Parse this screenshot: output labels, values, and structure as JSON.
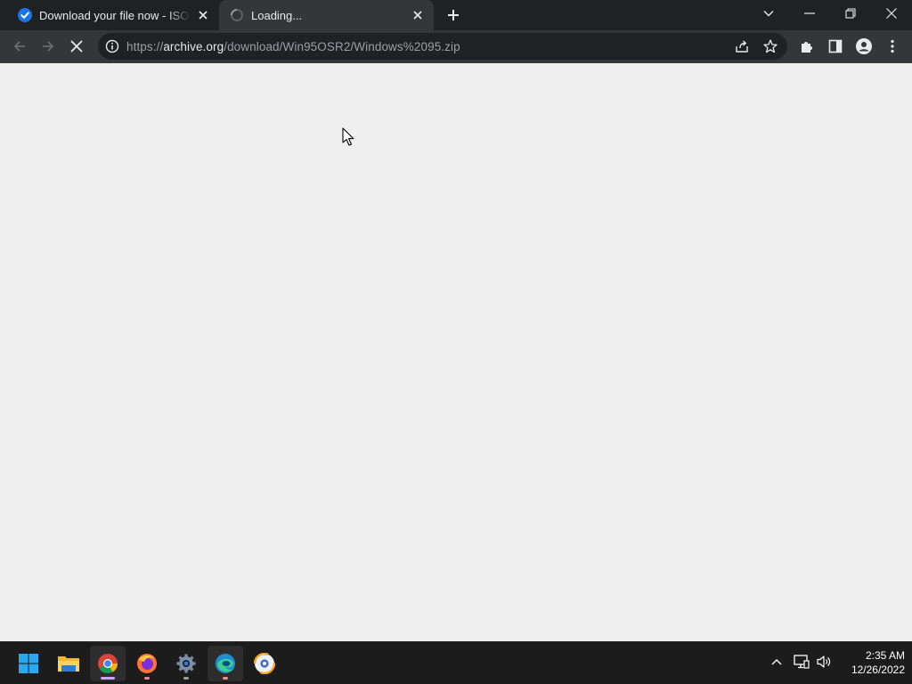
{
  "browser": {
    "tabs": [
      {
        "title": "Download your file now - ISORIVER",
        "favicon": "check-badge-icon",
        "active": false
      },
      {
        "title": "Loading...",
        "favicon": "loading-spinner-icon",
        "active": true
      }
    ],
    "address_bar": {
      "scheme": "https://",
      "host": "archive.org",
      "path": "/download/Win95OSR2/Windows%2095.zip"
    }
  },
  "taskbar": {
    "apps": [
      {
        "name": "Start",
        "icon": "windows-logo-icon"
      },
      {
        "name": "File Explorer",
        "icon": "folder-icon"
      },
      {
        "name": "Google Chrome",
        "icon": "chrome-icon"
      },
      {
        "name": "Firefox",
        "icon": "firefox-icon"
      },
      {
        "name": "Settings",
        "icon": "gear-icon"
      },
      {
        "name": "Microsoft Edge",
        "icon": "edge-icon"
      },
      {
        "name": "Brave",
        "icon": "brave-icon"
      }
    ],
    "clock": {
      "time": "2:35 AM",
      "date": "12/26/2022"
    }
  },
  "colors": {
    "tabstrip_bg": "#202124",
    "toolbar_bg": "#35363a",
    "page_bg": "#efefef",
    "taskbar_bg": "#1c1c1c"
  }
}
